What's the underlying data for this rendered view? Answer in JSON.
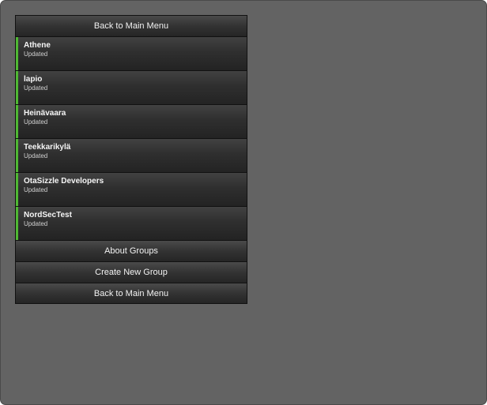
{
  "top_button": {
    "label": "Back to Main Menu"
  },
  "groups": [
    {
      "name": "Athene",
      "status": "Updated"
    },
    {
      "name": "lapio",
      "status": "Updated"
    },
    {
      "name": "Heinävaara",
      "status": "Updated"
    },
    {
      "name": "Teekkarikylä",
      "status": "Updated"
    },
    {
      "name": "OtaSizzle Developers",
      "status": "Updated"
    },
    {
      "name": "NordSecTest",
      "status": "Updated"
    }
  ],
  "bottom_buttons": {
    "about": "About Groups",
    "create": "Create New Group",
    "back": "Back to Main Menu"
  },
  "colors": {
    "background": "#636363",
    "item_dark": "#2f2f2f",
    "accent_green": "#4fb833",
    "text": "#f2f2f2"
  }
}
